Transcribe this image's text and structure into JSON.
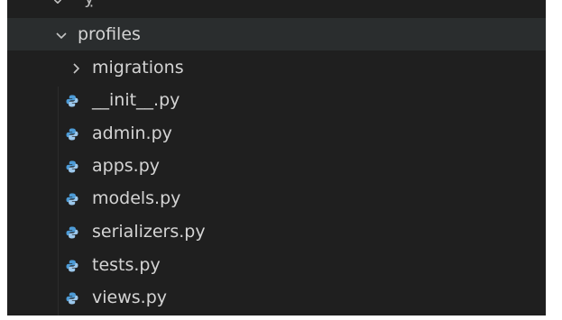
{
  "explorer": {
    "folder": {
      "name": "profiles",
      "expanded": true,
      "chevron_icon": "chevron-down-icon"
    },
    "children": [
      {
        "kind": "folder",
        "name": "migrations",
        "expanded": false,
        "icon": "chevron-right-icon"
      },
      {
        "kind": "file",
        "name": "__init__.py",
        "icon": "python-file-icon"
      },
      {
        "kind": "file",
        "name": "admin.py",
        "icon": "python-file-icon"
      },
      {
        "kind": "file",
        "name": "apps.py",
        "icon": "python-file-icon"
      },
      {
        "kind": "file",
        "name": "models.py",
        "icon": "python-file-icon"
      },
      {
        "kind": "file",
        "name": "serializers.py",
        "icon": "python-file-icon"
      },
      {
        "kind": "file",
        "name": "tests.py",
        "icon": "python-file-icon"
      },
      {
        "kind": "file",
        "name": "views.py",
        "icon": "python-file-icon"
      }
    ]
  },
  "colors": {
    "background": "#1f1f1f",
    "selected_row": "#2a2d2e",
    "text": "#d4d4d4",
    "python_icon_blue": "#4d9bd6",
    "python_icon_light": "#9cc8ec"
  }
}
